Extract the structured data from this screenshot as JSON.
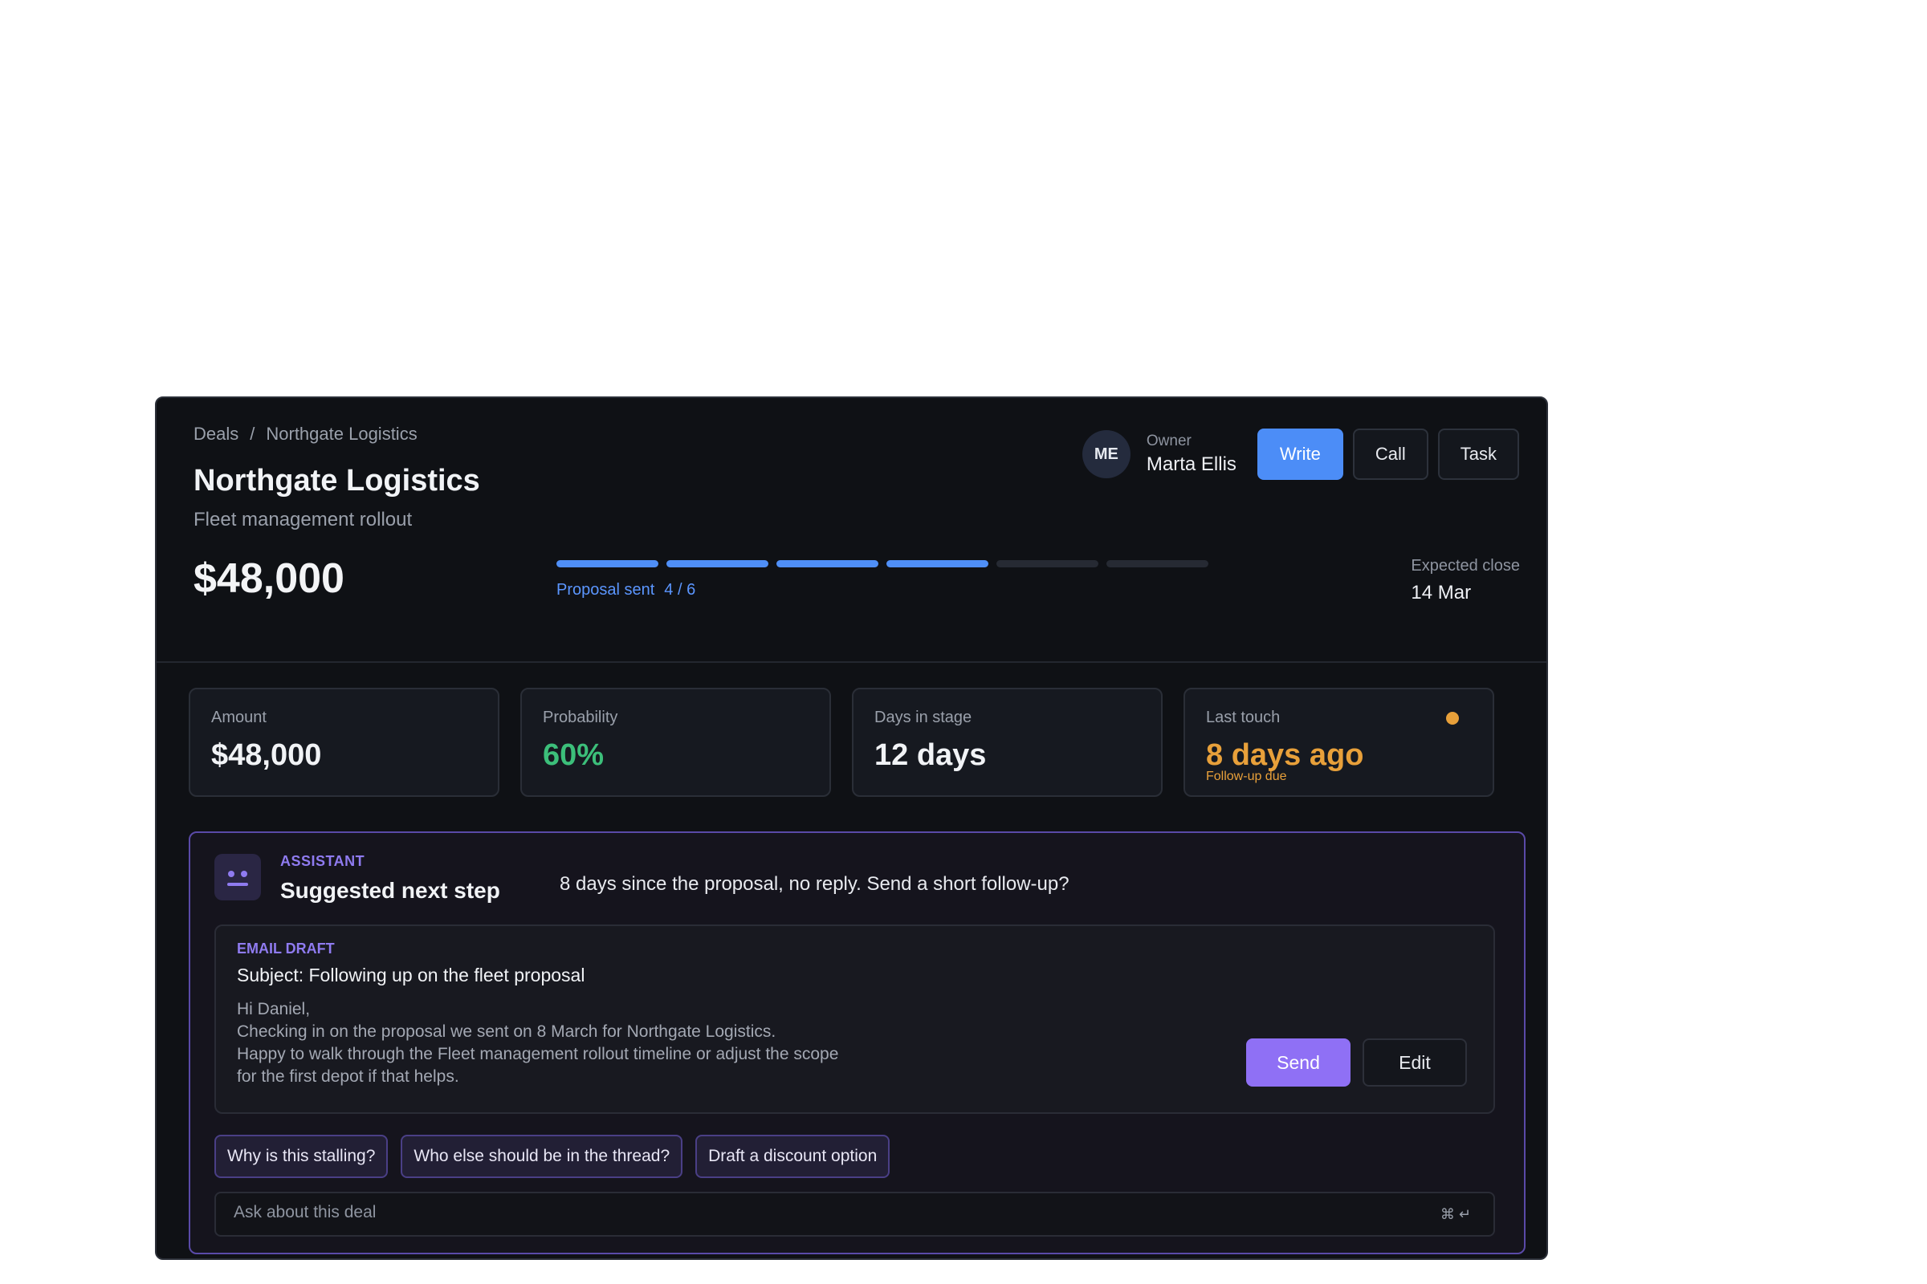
{
  "breadcrumb": {
    "root": "Deals",
    "separator": "/",
    "current": "Northgate Logistics"
  },
  "deal": {
    "title": "Northgate Logistics",
    "subtitle": "Fleet management rollout",
    "amount": "$48,000"
  },
  "pipeline": {
    "stage_name": "Proposal sent",
    "stage_count": "4 / 6",
    "completed": 4,
    "total": 6,
    "accent": "#4f8ff7"
  },
  "owner": {
    "initials": "ME",
    "label": "Owner",
    "name": "Marta Ellis"
  },
  "actions": {
    "write": "Write",
    "call": "Call",
    "task": "Task"
  },
  "expected_close": {
    "label": "Expected close",
    "value": "14 Mar"
  },
  "stats": {
    "amount": {
      "label": "Amount",
      "value": "$48,000"
    },
    "probability": {
      "label": "Probability",
      "value": "60%",
      "color": "#3cbf7a"
    },
    "days": {
      "label": "Days in stage",
      "value": "12 days"
    },
    "last_touch": {
      "label": "Last touch",
      "value": "8 days ago",
      "note": "Follow-up due",
      "color": "#e8a03a"
    }
  },
  "assistant": {
    "tag": "ASSISTANT",
    "title": "Suggested next step",
    "message": "8 days since the proposal, no reply. Send a short follow-up?",
    "icon": "bot-face-icon",
    "draft": {
      "tag": "EMAIL DRAFT",
      "subject": "Subject: Following up on the fleet proposal",
      "lines": [
        "Hi Daniel,",
        "Checking in on the proposal we sent on 8 March for Northgate Logistics.",
        "Happy to walk through the Fleet management rollout timeline or adjust the scope",
        "for the first depot if that helps."
      ],
      "send": "Send",
      "edit": "Edit"
    },
    "chips": [
      "Why is this stalling?",
      "Who else should be in the thread?",
      "Draft a discount option"
    ],
    "input_placeholder": "Ask about this deal",
    "shortcut": "⌘ ↵"
  }
}
